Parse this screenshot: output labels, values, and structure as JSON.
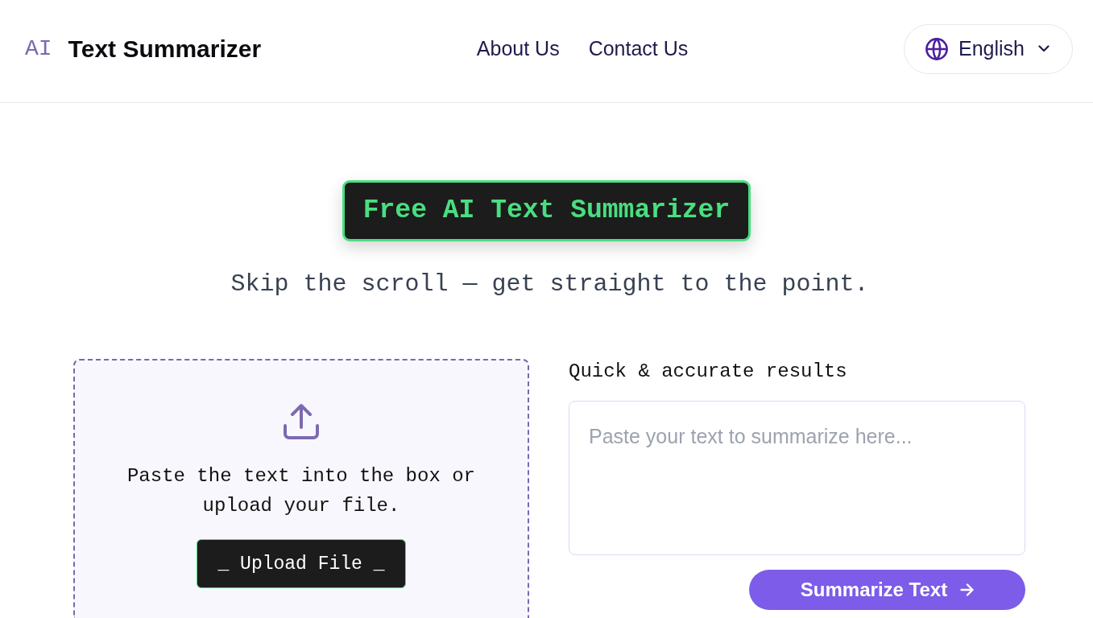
{
  "header": {
    "logo_mark": "AI",
    "logo_text": "Text Summarizer",
    "nav_links": [
      "About Us",
      "Contact Us"
    ],
    "language_selector": {
      "value": "English"
    }
  },
  "hero": {
    "badge": "Free AI Text Summarizer",
    "subtitle": "Skip the scroll — get straight to the point."
  },
  "upload_panel": {
    "instructions": "Paste the text into the box or upload your file.",
    "button": "_ Upload File _"
  },
  "summarize_panel": {
    "label": "Quick & accurate results",
    "text_input": {
      "placeholder": "Paste your text to summarize here..."
    },
    "button": "Summarize Text"
  }
}
